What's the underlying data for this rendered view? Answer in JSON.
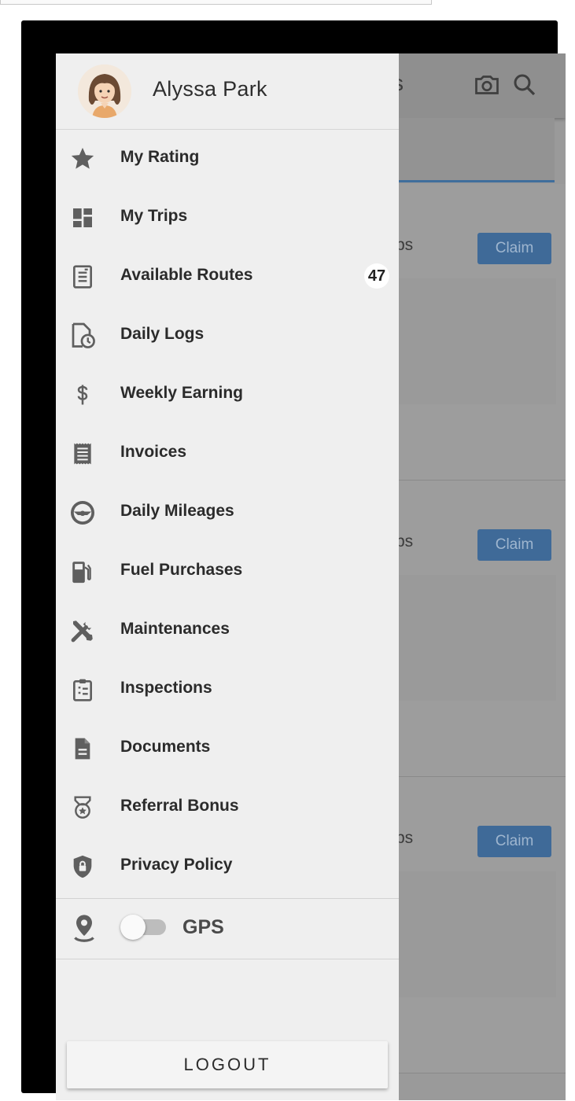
{
  "background_app": {
    "title_tail": "s",
    "cards": [
      {
        "text": "bs",
        "claim_label": "Claim"
      },
      {
        "text": "bs",
        "claim_label": "Claim"
      },
      {
        "text": "bs",
        "claim_label": "Claim"
      }
    ]
  },
  "drawer": {
    "user_name": "Alyssa Park",
    "items": [
      {
        "label": "My Rating",
        "icon": "star-icon"
      },
      {
        "label": "My Trips",
        "icon": "dashboard-icon"
      },
      {
        "label": "Available Routes",
        "icon": "list-icon",
        "badge": "47"
      },
      {
        "label": "Daily Logs",
        "icon": "log-clock-icon"
      },
      {
        "label": "Weekly Earning",
        "icon": "dollar-icon"
      },
      {
        "label": "Invoices",
        "icon": "receipt-icon"
      },
      {
        "label": "Daily Mileages",
        "icon": "steering-wheel-icon"
      },
      {
        "label": "Fuel Purchases",
        "icon": "fuel-pump-icon"
      },
      {
        "label": "Maintenances",
        "icon": "tools-icon"
      },
      {
        "label": "Inspections",
        "icon": "clipboard-icon"
      },
      {
        "label": "Documents",
        "icon": "document-icon"
      },
      {
        "label": "Referral Bonus",
        "icon": "medal-icon"
      },
      {
        "label": "Privacy Policy",
        "icon": "shield-lock-icon"
      }
    ],
    "gps_label": "GPS",
    "gps_enabled": false,
    "logout_label": "LOGOUT"
  }
}
